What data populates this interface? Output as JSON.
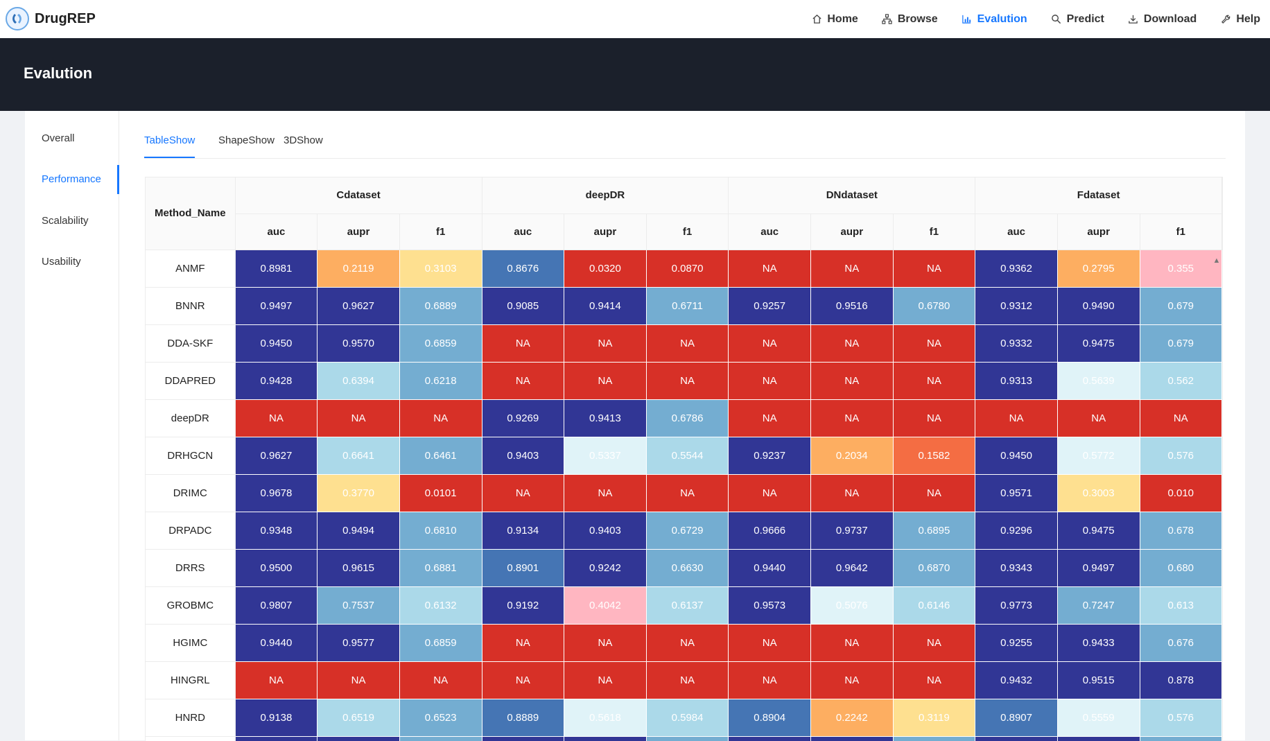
{
  "brand": {
    "name": "DrugREP"
  },
  "nav": [
    {
      "label": "Home",
      "icon": "home-icon"
    },
    {
      "label": "Browse",
      "icon": "sitemap-icon"
    },
    {
      "label": "Evalution",
      "icon": "bar-chart-icon",
      "active": true
    },
    {
      "label": "Predict",
      "icon": "search-icon"
    },
    {
      "label": "Download",
      "icon": "download-icon"
    },
    {
      "label": "Help",
      "icon": "wrench-icon"
    }
  ],
  "page_title": "Evalution",
  "sidebar": [
    {
      "label": "Overall"
    },
    {
      "label": "Performance",
      "active": true
    },
    {
      "label": "Scalability"
    },
    {
      "label": "Usability"
    }
  ],
  "tabs": [
    {
      "label": "TableShow",
      "active": true
    },
    {
      "label": "ShapeShow"
    },
    {
      "label": "3DShow"
    }
  ],
  "table": {
    "method_header": "Method_Name",
    "datasets": [
      "Cdataset",
      "deepDR",
      "DNdataset",
      "Fdataset"
    ],
    "metrics": [
      "auc",
      "aupr",
      "f1"
    ],
    "colors": {
      "na": "#d73027",
      "c_darkblue": "#313695",
      "c_blue": "#4575b4",
      "c_midblue": "#74add1",
      "c_lightblue": "#abd9e9",
      "c_paleblue": "#e0f3f8",
      "c_yellow": "#fee090",
      "c_orange": "#fdae61",
      "c_redorange": "#f46d43",
      "c_pink": "#ffb6c1"
    },
    "rows": [
      {
        "method": "ANMF",
        "values": [
          "0.8981",
          "0.2119",
          "0.3103",
          "0.8676",
          "0.0320",
          "0.0870",
          "NA",
          "NA",
          "NA",
          "0.9362",
          "0.2795",
          "0.355"
        ],
        "colors": [
          "c_darkblue",
          "c_orange",
          "c_yellow",
          "c_blue",
          "na",
          "na",
          "na",
          "na",
          "na",
          "c_darkblue",
          "c_orange",
          "c_pink"
        ]
      },
      {
        "method": "BNNR",
        "values": [
          "0.9497",
          "0.9627",
          "0.6889",
          "0.9085",
          "0.9414",
          "0.6711",
          "0.9257",
          "0.9516",
          "0.6780",
          "0.9312",
          "0.9490",
          "0.679"
        ],
        "colors": [
          "c_darkblue",
          "c_darkblue",
          "c_midblue",
          "c_darkblue",
          "c_darkblue",
          "c_midblue",
          "c_darkblue",
          "c_darkblue",
          "c_midblue",
          "c_darkblue",
          "c_darkblue",
          "c_midblue"
        ]
      },
      {
        "method": "DDA-SKF",
        "values": [
          "0.9450",
          "0.9570",
          "0.6859",
          "NA",
          "NA",
          "NA",
          "NA",
          "NA",
          "NA",
          "0.9332",
          "0.9475",
          "0.679"
        ],
        "colors": [
          "c_darkblue",
          "c_darkblue",
          "c_midblue",
          "na",
          "na",
          "na",
          "na",
          "na",
          "na",
          "c_darkblue",
          "c_darkblue",
          "c_midblue"
        ]
      },
      {
        "method": "DDAPRED",
        "values": [
          "0.9428",
          "0.6394",
          "0.6218",
          "NA",
          "NA",
          "NA",
          "NA",
          "NA",
          "NA",
          "0.9313",
          "0.5639",
          "0.562"
        ],
        "colors": [
          "c_darkblue",
          "c_lightblue",
          "c_midblue",
          "na",
          "na",
          "na",
          "na",
          "na",
          "na",
          "c_darkblue",
          "c_paleblue",
          "c_lightblue"
        ]
      },
      {
        "method": "deepDR",
        "values": [
          "NA",
          "NA",
          "NA",
          "0.9269",
          "0.9413",
          "0.6786",
          "NA",
          "NA",
          "NA",
          "NA",
          "NA",
          "NA"
        ],
        "colors": [
          "na",
          "na",
          "na",
          "c_darkblue",
          "c_darkblue",
          "c_midblue",
          "na",
          "na",
          "na",
          "na",
          "na",
          "na"
        ]
      },
      {
        "method": "DRHGCN",
        "values": [
          "0.9627",
          "0.6641",
          "0.6461",
          "0.9403",
          "0.5337",
          "0.5544",
          "0.9237",
          "0.2034",
          "0.1582",
          "0.9450",
          "0.5772",
          "0.576"
        ],
        "colors": [
          "c_darkblue",
          "c_lightblue",
          "c_midblue",
          "c_darkblue",
          "c_paleblue",
          "c_lightblue",
          "c_darkblue",
          "c_orange",
          "c_redorange",
          "c_darkblue",
          "c_paleblue",
          "c_lightblue"
        ]
      },
      {
        "method": "DRIMC",
        "values": [
          "0.9678",
          "0.3770",
          "0.0101",
          "NA",
          "NA",
          "NA",
          "NA",
          "NA",
          "NA",
          "0.9571",
          "0.3003",
          "0.010"
        ],
        "colors": [
          "c_darkblue",
          "c_yellow",
          "na",
          "na",
          "na",
          "na",
          "na",
          "na",
          "na",
          "c_darkblue",
          "c_yellow",
          "na"
        ]
      },
      {
        "method": "DRPADC",
        "values": [
          "0.9348",
          "0.9494",
          "0.6810",
          "0.9134",
          "0.9403",
          "0.6729",
          "0.9666",
          "0.9737",
          "0.6895",
          "0.9296",
          "0.9475",
          "0.678"
        ],
        "colors": [
          "c_darkblue",
          "c_darkblue",
          "c_midblue",
          "c_darkblue",
          "c_darkblue",
          "c_midblue",
          "c_darkblue",
          "c_darkblue",
          "c_midblue",
          "c_darkblue",
          "c_darkblue",
          "c_midblue"
        ]
      },
      {
        "method": "DRRS",
        "values": [
          "0.9500",
          "0.9615",
          "0.6881",
          "0.8901",
          "0.9242",
          "0.6630",
          "0.9440",
          "0.9642",
          "0.6870",
          "0.9343",
          "0.9497",
          "0.680"
        ],
        "colors": [
          "c_darkblue",
          "c_darkblue",
          "c_midblue",
          "c_blue",
          "c_darkblue",
          "c_midblue",
          "c_darkblue",
          "c_darkblue",
          "c_midblue",
          "c_darkblue",
          "c_darkblue",
          "c_midblue"
        ]
      },
      {
        "method": "GROBMC",
        "values": [
          "0.9807",
          "0.7537",
          "0.6132",
          "0.9192",
          "0.4042",
          "0.6137",
          "0.9573",
          "0.5076",
          "0.6146",
          "0.9773",
          "0.7247",
          "0.613"
        ],
        "colors": [
          "c_darkblue",
          "c_midblue",
          "c_lightblue",
          "c_darkblue",
          "c_pink",
          "c_lightblue",
          "c_darkblue",
          "c_paleblue",
          "c_lightblue",
          "c_darkblue",
          "c_midblue",
          "c_lightblue"
        ]
      },
      {
        "method": "HGIMC",
        "values": [
          "0.9440",
          "0.9577",
          "0.6859",
          "NA",
          "NA",
          "NA",
          "NA",
          "NA",
          "NA",
          "0.9255",
          "0.9433",
          "0.676"
        ],
        "colors": [
          "c_darkblue",
          "c_darkblue",
          "c_midblue",
          "na",
          "na",
          "na",
          "na",
          "na",
          "na",
          "c_darkblue",
          "c_darkblue",
          "c_midblue"
        ]
      },
      {
        "method": "HINGRL",
        "values": [
          "NA",
          "NA",
          "NA",
          "NA",
          "NA",
          "NA",
          "NA",
          "NA",
          "NA",
          "0.9432",
          "0.9515",
          "0.878"
        ],
        "colors": [
          "na",
          "na",
          "na",
          "na",
          "na",
          "na",
          "na",
          "na",
          "na",
          "c_darkblue",
          "c_darkblue",
          "c_darkblue"
        ]
      },
      {
        "method": "HNRD",
        "values": [
          "0.9138",
          "0.6519",
          "0.6523",
          "0.8889",
          "0.5618",
          "0.5984",
          "0.8904",
          "0.2242",
          "0.3119",
          "0.8907",
          "0.5559",
          "0.576"
        ],
        "colors": [
          "c_darkblue",
          "c_lightblue",
          "c_midblue",
          "c_blue",
          "c_paleblue",
          "c_lightblue",
          "c_blue",
          "c_orange",
          "c_yellow",
          "c_blue",
          "c_paleblue",
          "c_lightblue"
        ]
      },
      {
        "method": "",
        "values": [
          "",
          "",
          "",
          "",
          "",
          "",
          "",
          "",
          "",
          "",
          "",
          ""
        ],
        "colors": [
          "c_darkblue",
          "c_darkblue",
          "c_midblue",
          "c_darkblue",
          "c_darkblue",
          "c_midblue",
          "c_darkblue",
          "c_darkblue",
          "c_midblue",
          "c_darkblue",
          "c_darkblue",
          "c_midblue"
        ]
      }
    ]
  }
}
